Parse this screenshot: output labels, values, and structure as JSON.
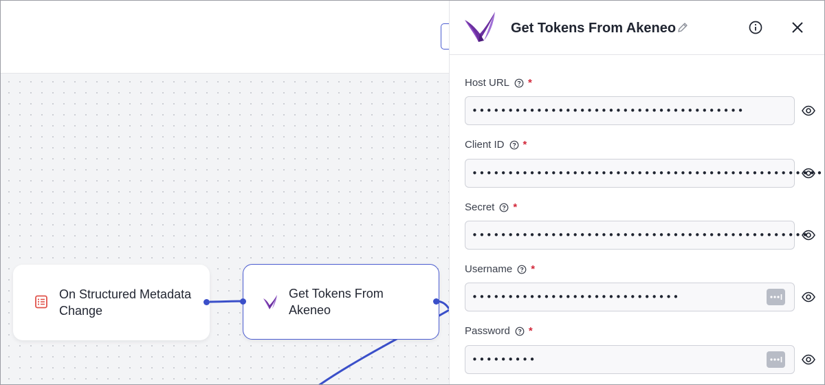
{
  "canvas": {
    "nodes": [
      {
        "label": "On Structured Metadata Change",
        "icon": "structured-metadata-icon"
      },
      {
        "label": "Get Tokens From Akeneo",
        "icon": "akeneo-logo-icon"
      }
    ]
  },
  "panel": {
    "title": "Get Tokens From Akeneo",
    "logo": "akeneo-logo-icon",
    "fields": [
      {
        "label": "Host URL",
        "required_mark": "*",
        "value": "••••••••••••••••••••••••••••••••••••••",
        "password_manager": false
      },
      {
        "label": "Client ID",
        "required_mark": "*",
        "value": "•••••••••••••••••••••••••••••••••••••••••••••••••",
        "password_manager": false
      },
      {
        "label": "Secret",
        "required_mark": "*",
        "value": "•••••••••••••••••••••••••••••••••••••••••••••••",
        "password_manager": false
      },
      {
        "label": "Username",
        "required_mark": "*",
        "value": "•••••••••••••••••••••••••••••",
        "password_manager": true
      },
      {
        "label": "Password",
        "required_mark": "*",
        "value": "•••••••••",
        "password_manager": true
      }
    ]
  },
  "colors": {
    "accent": "#3a4fc9",
    "required": "#d2283a",
    "akeneo_purple": "#6b2fa0"
  }
}
